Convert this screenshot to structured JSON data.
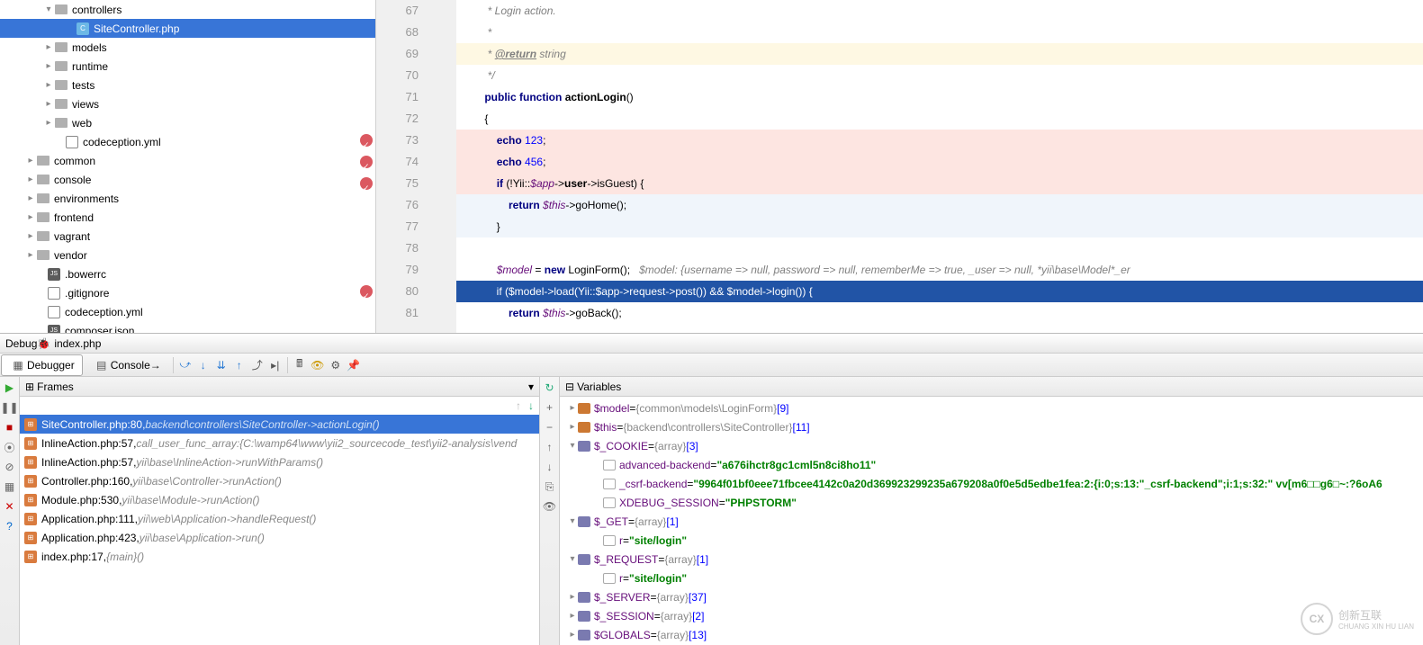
{
  "tree": {
    "items": [
      {
        "indent": 48,
        "arrow": "d",
        "icon": "folder",
        "label": "controllers"
      },
      {
        "indent": 72,
        "arrow": "",
        "icon": "php",
        "label": "SiteController.php",
        "selected": true
      },
      {
        "indent": 48,
        "arrow": "r",
        "icon": "folder",
        "label": "models"
      },
      {
        "indent": 48,
        "arrow": "r",
        "icon": "folder",
        "label": "runtime"
      },
      {
        "indent": 48,
        "arrow": "r",
        "icon": "folder",
        "label": "tests"
      },
      {
        "indent": 48,
        "arrow": "r",
        "icon": "folder",
        "label": "views"
      },
      {
        "indent": 48,
        "arrow": "r",
        "icon": "folder",
        "label": "web"
      },
      {
        "indent": 60,
        "arrow": "",
        "icon": "yml",
        "label": "codeception.yml"
      },
      {
        "indent": 28,
        "arrow": "r",
        "icon": "folder",
        "label": "common"
      },
      {
        "indent": 28,
        "arrow": "r",
        "icon": "folder",
        "label": "console"
      },
      {
        "indent": 28,
        "arrow": "r",
        "icon": "folder",
        "label": "environments"
      },
      {
        "indent": 28,
        "arrow": "r",
        "icon": "folder",
        "label": "frontend"
      },
      {
        "indent": 28,
        "arrow": "r",
        "icon": "folder",
        "label": "vagrant"
      },
      {
        "indent": 28,
        "arrow": "r",
        "icon": "folder",
        "label": "vendor"
      },
      {
        "indent": 40,
        "arrow": "",
        "icon": "json",
        "label": ".bowerrc"
      },
      {
        "indent": 40,
        "arrow": "",
        "icon": "txt",
        "label": ".gitignore"
      },
      {
        "indent": 40,
        "arrow": "",
        "icon": "yml",
        "label": "codeception.yml"
      },
      {
        "indent": 40,
        "arrow": "",
        "icon": "json",
        "label": "composer.json"
      }
    ]
  },
  "editor": {
    "lines": [
      {
        "n": 67,
        "cls": "",
        "html": "        <span class='com'>* Login action.</span>"
      },
      {
        "n": 68,
        "cls": "",
        "html": "        <span class='com'>*</span>"
      },
      {
        "n": 69,
        "cls": "hl-yellow",
        "html": "        <span class='com'>* <span class='doctag'>@return</span> string</span>"
      },
      {
        "n": 70,
        "cls": "",
        "html": "        <span class='com'>*/</span>"
      },
      {
        "n": 71,
        "cls": "",
        "html": "       <span class='kw'>public function</span> <span class='fn'>actionLogin</span>()"
      },
      {
        "n": 72,
        "cls": "",
        "html": "       {"
      },
      {
        "n": 73,
        "cls": "hl-red",
        "bp": true,
        "html": "           <span class='kw'>echo</span> <span class='num'>123</span>;"
      },
      {
        "n": 74,
        "cls": "hl-red",
        "bp": true,
        "html": "           <span class='kw'>echo</span> <span class='num'>456</span>;"
      },
      {
        "n": 75,
        "cls": "hl-red",
        "bp": true,
        "html": "           <span class='kw'>if</span> (!Yii::<span class='var'>$app</span>-&gt;<span class='fn'>user</span>-&gt;isGuest) {"
      },
      {
        "n": 76,
        "cls": "hl-blue",
        "html": "               <span class='kw'>return</span> <span class='var'>$this</span>-&gt;goHome();"
      },
      {
        "n": 77,
        "cls": "hl-blue",
        "html": "           }"
      },
      {
        "n": 78,
        "cls": "",
        "html": ""
      },
      {
        "n": 79,
        "cls": "",
        "html": "           <span class='var'>$model</span> = <span class='kw'>new</span> LoginForm();   <span class='hint'>$model: {username =&gt; null, password =&gt; null, rememberMe =&gt; true, _user =&gt; null, *yii\\base\\Model*_er</span>"
      },
      {
        "n": 80,
        "cls": "exec",
        "bp": true,
        "html": "           if ($model-&gt;load(Yii::$app-&gt;request-&gt;post()) &amp;&amp; $model-&gt;login()) {"
      },
      {
        "n": 81,
        "cls": "",
        "html": "               <span class='kw'>return</span> <span class='var'>$this</span>-&gt;goBack();"
      }
    ]
  },
  "debugTab": {
    "label": "Debug",
    "file": "index.php"
  },
  "toolbar": {
    "debugger": "Debugger",
    "console": "Console"
  },
  "framesPanel": {
    "title": "Frames"
  },
  "variablesPanel": {
    "title": "Variables"
  },
  "frames": [
    {
      "file": "SiteController.php:80",
      "loc": "backend\\controllers\\SiteController->actionLogin()",
      "selected": true
    },
    {
      "file": "InlineAction.php:57",
      "loc": "call_user_func_array:{C:\\wamp64\\www\\yii2_sourcecode_test\\yii2-analysis\\vend"
    },
    {
      "file": "InlineAction.php:57",
      "loc": "yii\\base\\InlineAction->runWithParams()"
    },
    {
      "file": "Controller.php:160",
      "loc": "yii\\base\\Controller->runAction()"
    },
    {
      "file": "Module.php:530",
      "loc": "yii\\base\\Module->runAction()"
    },
    {
      "file": "Application.php:111",
      "loc": "yii\\web\\Application->handleRequest()"
    },
    {
      "file": "Application.php:423",
      "loc": "yii\\base\\Application->run()"
    },
    {
      "file": "index.php:17",
      "loc": "{main}()"
    }
  ],
  "variables": [
    {
      "indent": 0,
      "arrow": "r",
      "ico": "obj",
      "name": "$model",
      "eq": " = ",
      "type": "{common\\models\\LoginForm}",
      "suffix": " [9]"
    },
    {
      "indent": 0,
      "arrow": "r",
      "ico": "obj",
      "name": "$this",
      "eq": " = ",
      "type": "{backend\\controllers\\SiteController}",
      "suffix": " [11]"
    },
    {
      "indent": 0,
      "arrow": "d",
      "ico": "arr",
      "name": "$_COOKIE",
      "eq": " = ",
      "type": "{array}",
      "suffix": " [3]"
    },
    {
      "indent": 28,
      "arrow": "",
      "ico": "key",
      "name": "advanced-backend",
      "eq": " = ",
      "val": "\"a676ihctr8gc1cml5n8ci8ho11\""
    },
    {
      "indent": 28,
      "arrow": "",
      "ico": "key",
      "name": "_csrf-backend",
      "eq": " = ",
      "val": "\"9964f01bf0eee71fbcee4142c0a20d369923299235a679208a0f0e5d5edbe1fea:2:{i:0;s:13:\"_csrf-backend\";i:1;s:32:\" vv[m6□□g6□~:?6oA6"
    },
    {
      "indent": 28,
      "arrow": "",
      "ico": "key",
      "name": "XDEBUG_SESSION",
      "eq": " = ",
      "val": "\"PHPSTORM\""
    },
    {
      "indent": 0,
      "arrow": "d",
      "ico": "arr",
      "name": "$_GET",
      "eq": " = ",
      "type": "{array}",
      "suffix": " [1]"
    },
    {
      "indent": 28,
      "arrow": "",
      "ico": "key",
      "name": "r",
      "eq": " = ",
      "val": "\"site/login\""
    },
    {
      "indent": 0,
      "arrow": "d",
      "ico": "arr",
      "name": "$_REQUEST",
      "eq": " = ",
      "type": "{array}",
      "suffix": " [1]"
    },
    {
      "indent": 28,
      "arrow": "",
      "ico": "key",
      "name": "r",
      "eq": " = ",
      "val": "\"site/login\""
    },
    {
      "indent": 0,
      "arrow": "r",
      "ico": "arr",
      "name": "$_SERVER",
      "eq": " = ",
      "type": "{array}",
      "suffix": " [37]"
    },
    {
      "indent": 0,
      "arrow": "r",
      "ico": "arr",
      "name": "$_SESSION",
      "eq": " = ",
      "type": "{array}",
      "suffix": " [2]"
    },
    {
      "indent": 0,
      "arrow": "r",
      "ico": "arr",
      "name": "$GLOBALS",
      "eq": " = ",
      "type": "{array}",
      "suffix": " [13]"
    }
  ],
  "watermark": {
    "brand": "创新互联",
    "sub": "CHUANG XIN HU LIAN"
  }
}
